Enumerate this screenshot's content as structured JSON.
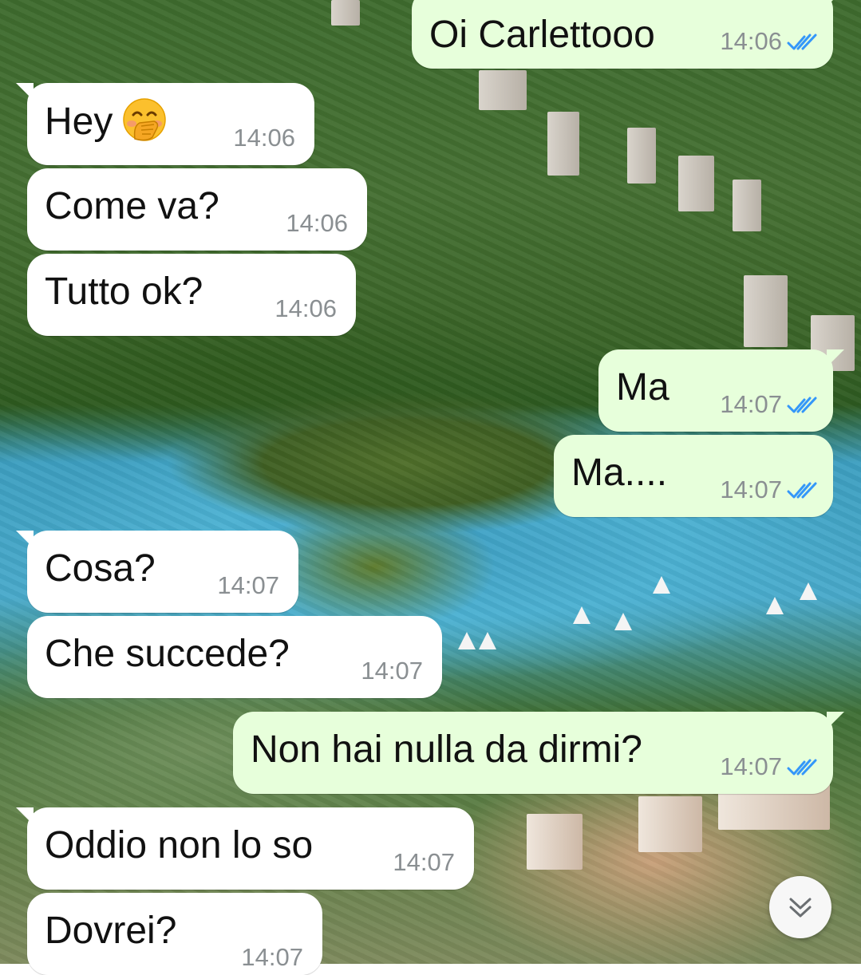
{
  "messages": [
    {
      "direction": "out",
      "text": "Oi Carlettooo",
      "time": "14:06",
      "status": "read"
    },
    {
      "direction": "in",
      "text": "Hey",
      "emoji": "face-with-hand-over-mouth",
      "time": "14:06"
    },
    {
      "direction": "in",
      "text": "Come va?",
      "time": "14:06"
    },
    {
      "direction": "in",
      "text": "Tutto ok?",
      "time": "14:06"
    },
    {
      "direction": "out",
      "text": "Ma",
      "time": "14:07",
      "status": "read"
    },
    {
      "direction": "out",
      "text": "Ma....",
      "time": "14:07",
      "status": "read"
    },
    {
      "direction": "in",
      "text": "Cosa?",
      "time": "14:07"
    },
    {
      "direction": "in",
      "text": "Che succede?",
      "time": "14:07"
    },
    {
      "direction": "out",
      "text": "Non hai nulla da dirmi?",
      "time": "14:07",
      "status": "read"
    },
    {
      "direction": "in",
      "text": "Oddio non lo so",
      "time": "14:07"
    },
    {
      "direction": "in",
      "text": "Dovrei?",
      "time": "14:07"
    }
  ],
  "scroll_button": {
    "icon": "double-chevron-down-icon"
  },
  "colors": {
    "incoming_bubble": "#ffffff",
    "outgoing_bubble": "#e7ffdb",
    "read_ticks": "#3497f9",
    "timestamp": "#8a8f92"
  }
}
